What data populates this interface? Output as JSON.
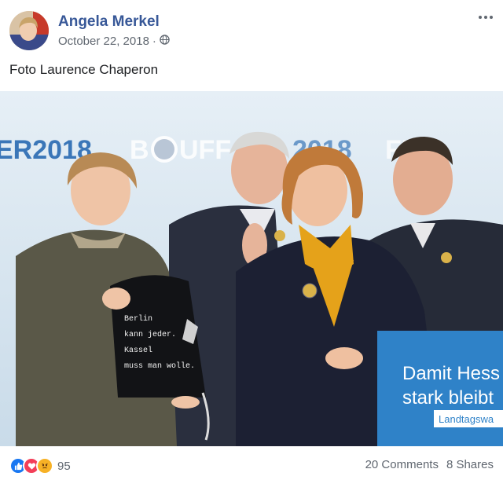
{
  "post": {
    "author": "Angela Merkel",
    "date": "October 22, 2018",
    "separator": "·",
    "privacy_icon": "globe-icon",
    "menu_icon": "more-icon",
    "caption": "Foto Laurence Chaperon"
  },
  "photo": {
    "backdrop_text_1": "ER2018",
    "backdrop_text_2": "B",
    "backdrop_text_3": "UFF",
    "backdrop_text_4": "2018",
    "backdrop_text_5": "FFIE",
    "bag_lines": [
      "Berlin",
      "kann jeder.",
      "Kassel",
      "muss man wolle."
    ],
    "podium_line_1": "Damit Hess",
    "podium_line_2": "stark bleibt",
    "podium_line_3": "Landtagswa",
    "colors": {
      "backdrop": "#dfeaf3",
      "podium": "#2f82c8",
      "accent_blue": "#3a76b8"
    }
  },
  "footer": {
    "reaction_icons": [
      "like-icon",
      "love-icon",
      "angry-icon"
    ],
    "reaction_count": "95",
    "comments": "20 Comments",
    "shares": "8 Shares"
  }
}
